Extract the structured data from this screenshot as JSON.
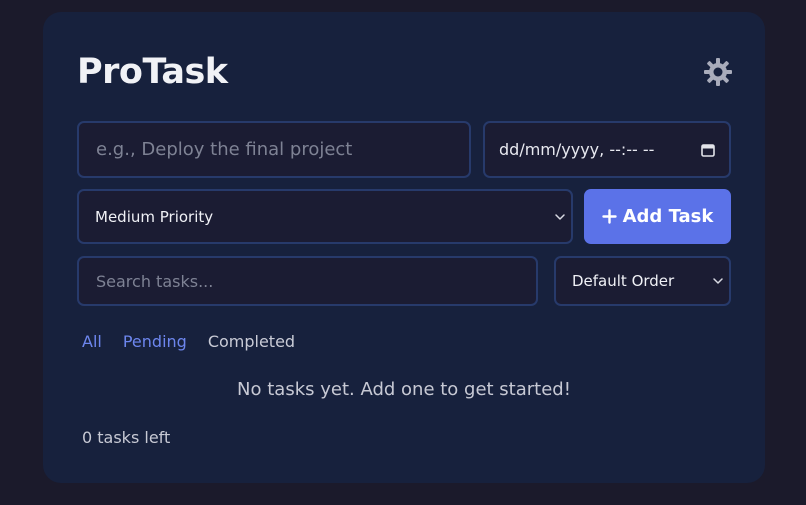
{
  "app": {
    "title": "ProTask"
  },
  "header": {
    "theme_icon": "sun-icon"
  },
  "form": {
    "task_placeholder": "e.g., Deploy the final project",
    "date_value": "dd/mm/yyyy, --:-- --",
    "date_icon": "calendar-icon",
    "priority_selected": "Medium Priority",
    "add_button_label": "Add Task",
    "add_button_icon": "plus-icon"
  },
  "toolbar": {
    "search_placeholder": "Search tasks...",
    "order_selected": "Default Order"
  },
  "filters": {
    "all": "All",
    "pending": "Pending",
    "completed": "Completed"
  },
  "list": {
    "empty_message": "No tasks yet. Add one to get started!"
  },
  "footer": {
    "count_text": "0 tasks left"
  },
  "colors": {
    "background": "#1b1a2b",
    "card": "#17213d",
    "accent": "#5b72e8",
    "field_border": "#273a6b"
  }
}
